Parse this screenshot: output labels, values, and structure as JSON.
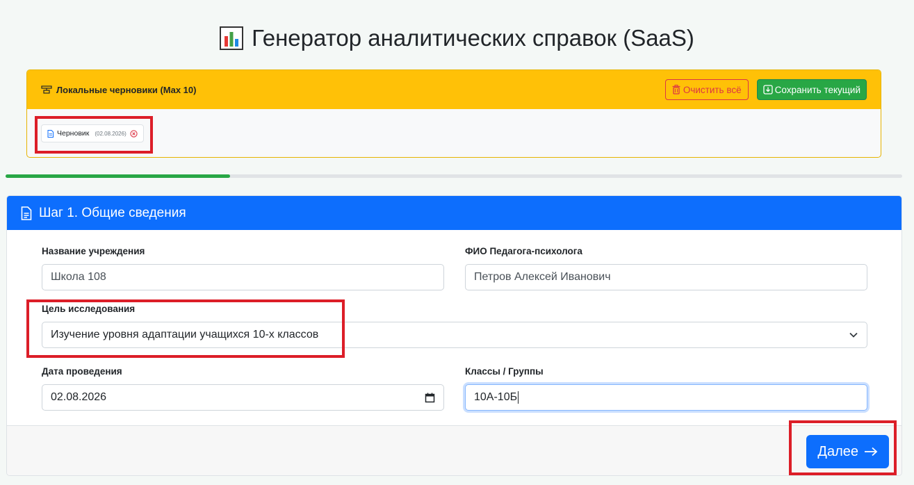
{
  "page": {
    "title": "Генератор аналитических справок (SaaS)",
    "title_icon": "bar-chart-icon"
  },
  "drafts": {
    "title": "Локальные черновики (Max 10)",
    "title_icon": "drafts-icon",
    "clear_label": "Очистить всё",
    "clear_icon": "trash-icon",
    "save_label": "Сохранить текущий",
    "save_icon": "download-icon",
    "items": [
      {
        "label": "Черновик",
        "date": "(02.08.2026)",
        "icon": "file-icon",
        "remove_icon": "x-circle-icon"
      }
    ]
  },
  "progress": {
    "value": 0.25
  },
  "step": {
    "title": "Шаг 1. Общие сведения",
    "icon": "document-icon"
  },
  "form": {
    "institution": {
      "label": "Название учреждения",
      "value": "Школа 108"
    },
    "psychologist": {
      "label": "ФИО Педагога-психолога",
      "value": "Петров Алексей Иванович"
    },
    "goal": {
      "label": "Цель исследования",
      "value": "Изучение уровня адаптации учащихся 10-х классов"
    },
    "date": {
      "label": "Дата проведения",
      "value": "02.08.2026"
    },
    "classes": {
      "label": "Классы / Группы",
      "value": "10А-10Б"
    }
  },
  "footer": {
    "next_label": "Далее",
    "next_icon": "arrow-right-icon"
  },
  "colors": {
    "primary": "#0d6efd",
    "warning": "#ffc107",
    "success": "#28a745",
    "danger": "#dc3545",
    "highlight": "#dc1e28"
  }
}
